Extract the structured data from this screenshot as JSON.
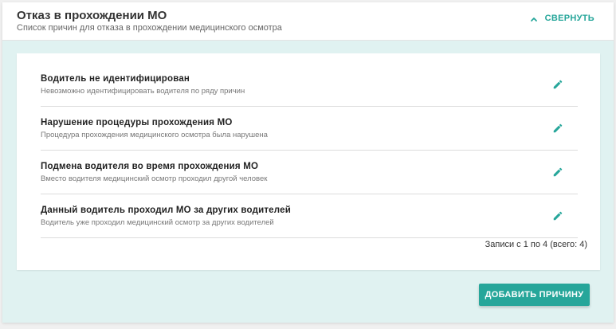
{
  "header": {
    "title": "Отказ в прохождении МО",
    "subtitle": "Список причин для отказа в прохождении медицинского осмотра",
    "collapse_label": "СВЕРНУТЬ",
    "collapse_icon": "chevron-up-icon"
  },
  "reasons": [
    {
      "title": "Водитель не идентифицирован",
      "description": "Невозможно идентифицировать водителя по ряду причин",
      "action_icon": "pencil-icon"
    },
    {
      "title": "Нарушение процедуры прохождения МО",
      "description": "Процедура прохождения медицинского осмотра была нарушена",
      "action_icon": "pencil-icon"
    },
    {
      "title": "Подмена водителя во время прохождения МО",
      "description": "Вместо водителя медицинский осмотр проходил другой человек",
      "action_icon": "pencil-icon"
    },
    {
      "title": "Данный водитель проходил МО за других водителей",
      "description": "Водитель уже проходил медицинский осмотр за других водителей",
      "action_icon": "pencil-icon"
    }
  ],
  "pagination": {
    "records_text": "Записи с 1 по 4 (всего: 4)"
  },
  "actions": {
    "add_label": "ДОБАВИТЬ ПРИЧИНУ"
  },
  "colors": {
    "accent": "#26a69a",
    "panel_background": "#e0f2f1",
    "card_background": "#ffffff",
    "title_text": "#333333",
    "muted_text": "#777777"
  }
}
